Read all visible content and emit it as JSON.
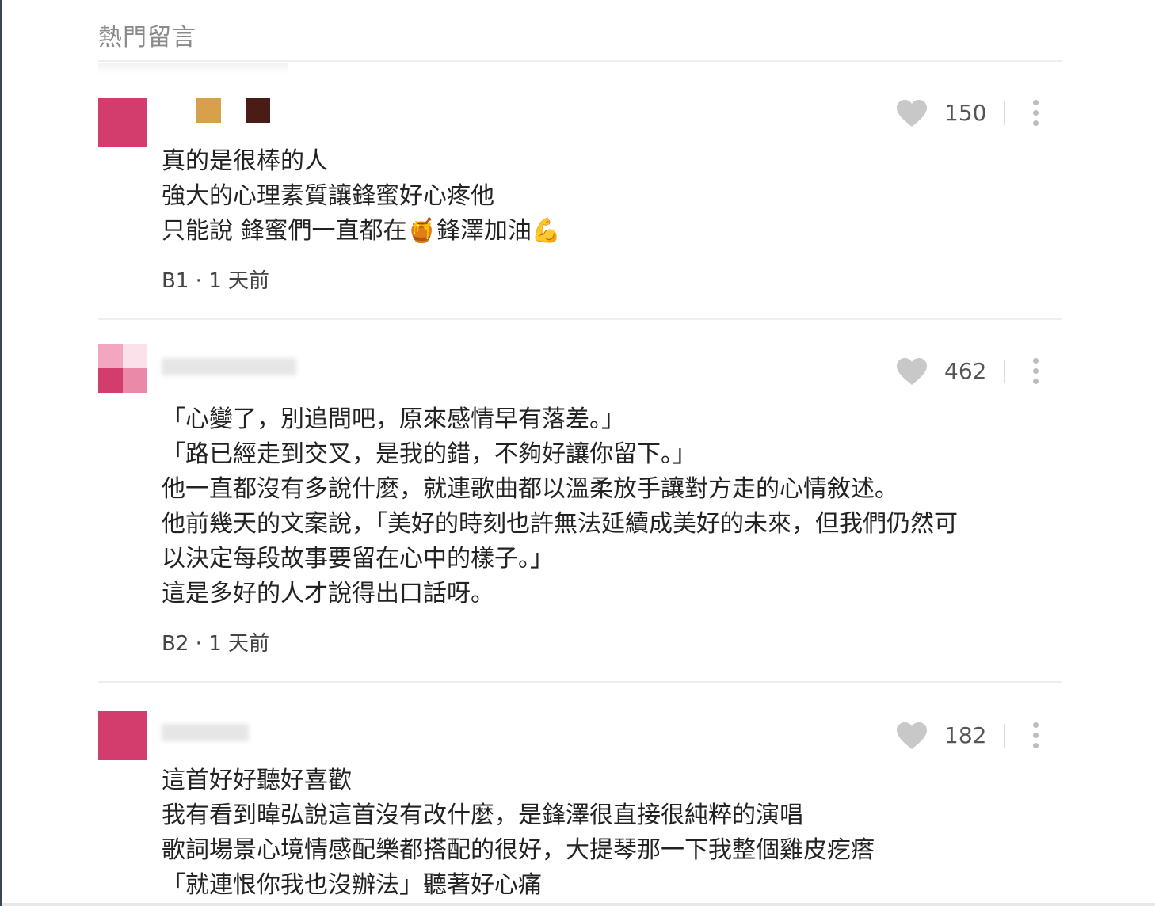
{
  "section": {
    "title": "熱門留言"
  },
  "comments": [
    {
      "floor": "B1",
      "time": "1 天前",
      "likes": "150",
      "lines": [
        "真的是很棒的人",
        "強大的心理素質讓鋒蜜好心疼他",
        "只能說 鋒蜜們一直都在"
      ],
      "line3_tail": "鋒澤加油",
      "emoji_honey": "🍯",
      "emoji_muscle": "💪"
    },
    {
      "floor": "B2",
      "time": "1 天前",
      "likes": "462",
      "lines": [
        "「心變了，別追問吧，原來感情早有落差。」",
        "「路已經走到交叉，是我的錯，不夠好讓你留下。」",
        "他一直都沒有多說什麼，就連歌曲都以溫柔放手讓對方走的心情敘述。",
        "他前幾天的文案說，「美好的時刻也許無法延續成美好的未來，但我們仍然可",
        "以決定每段故事要留在心中的樣子。」",
        "這是多好的人才說得出口話呀。"
      ]
    },
    {
      "likes": "182",
      "lines": [
        "這首好好聽好喜歡",
        "我有看到暐弘說這首沒有改什麼，是鋒澤很直接很純粹的演唱",
        "歌詞場景心境情感配樂都搭配的很好，大提琴那一下我整個雞皮疙瘩",
        "「就連恨你我也沒辦法」聽著好心痛"
      ]
    }
  ],
  "colors": {
    "heart": "#c8c8c8",
    "avatar_pink": "#d23d6e",
    "avatar_light": "#f4a3c0"
  },
  "icons": {
    "like": "heart-icon",
    "more": "more-vertical-icon"
  }
}
